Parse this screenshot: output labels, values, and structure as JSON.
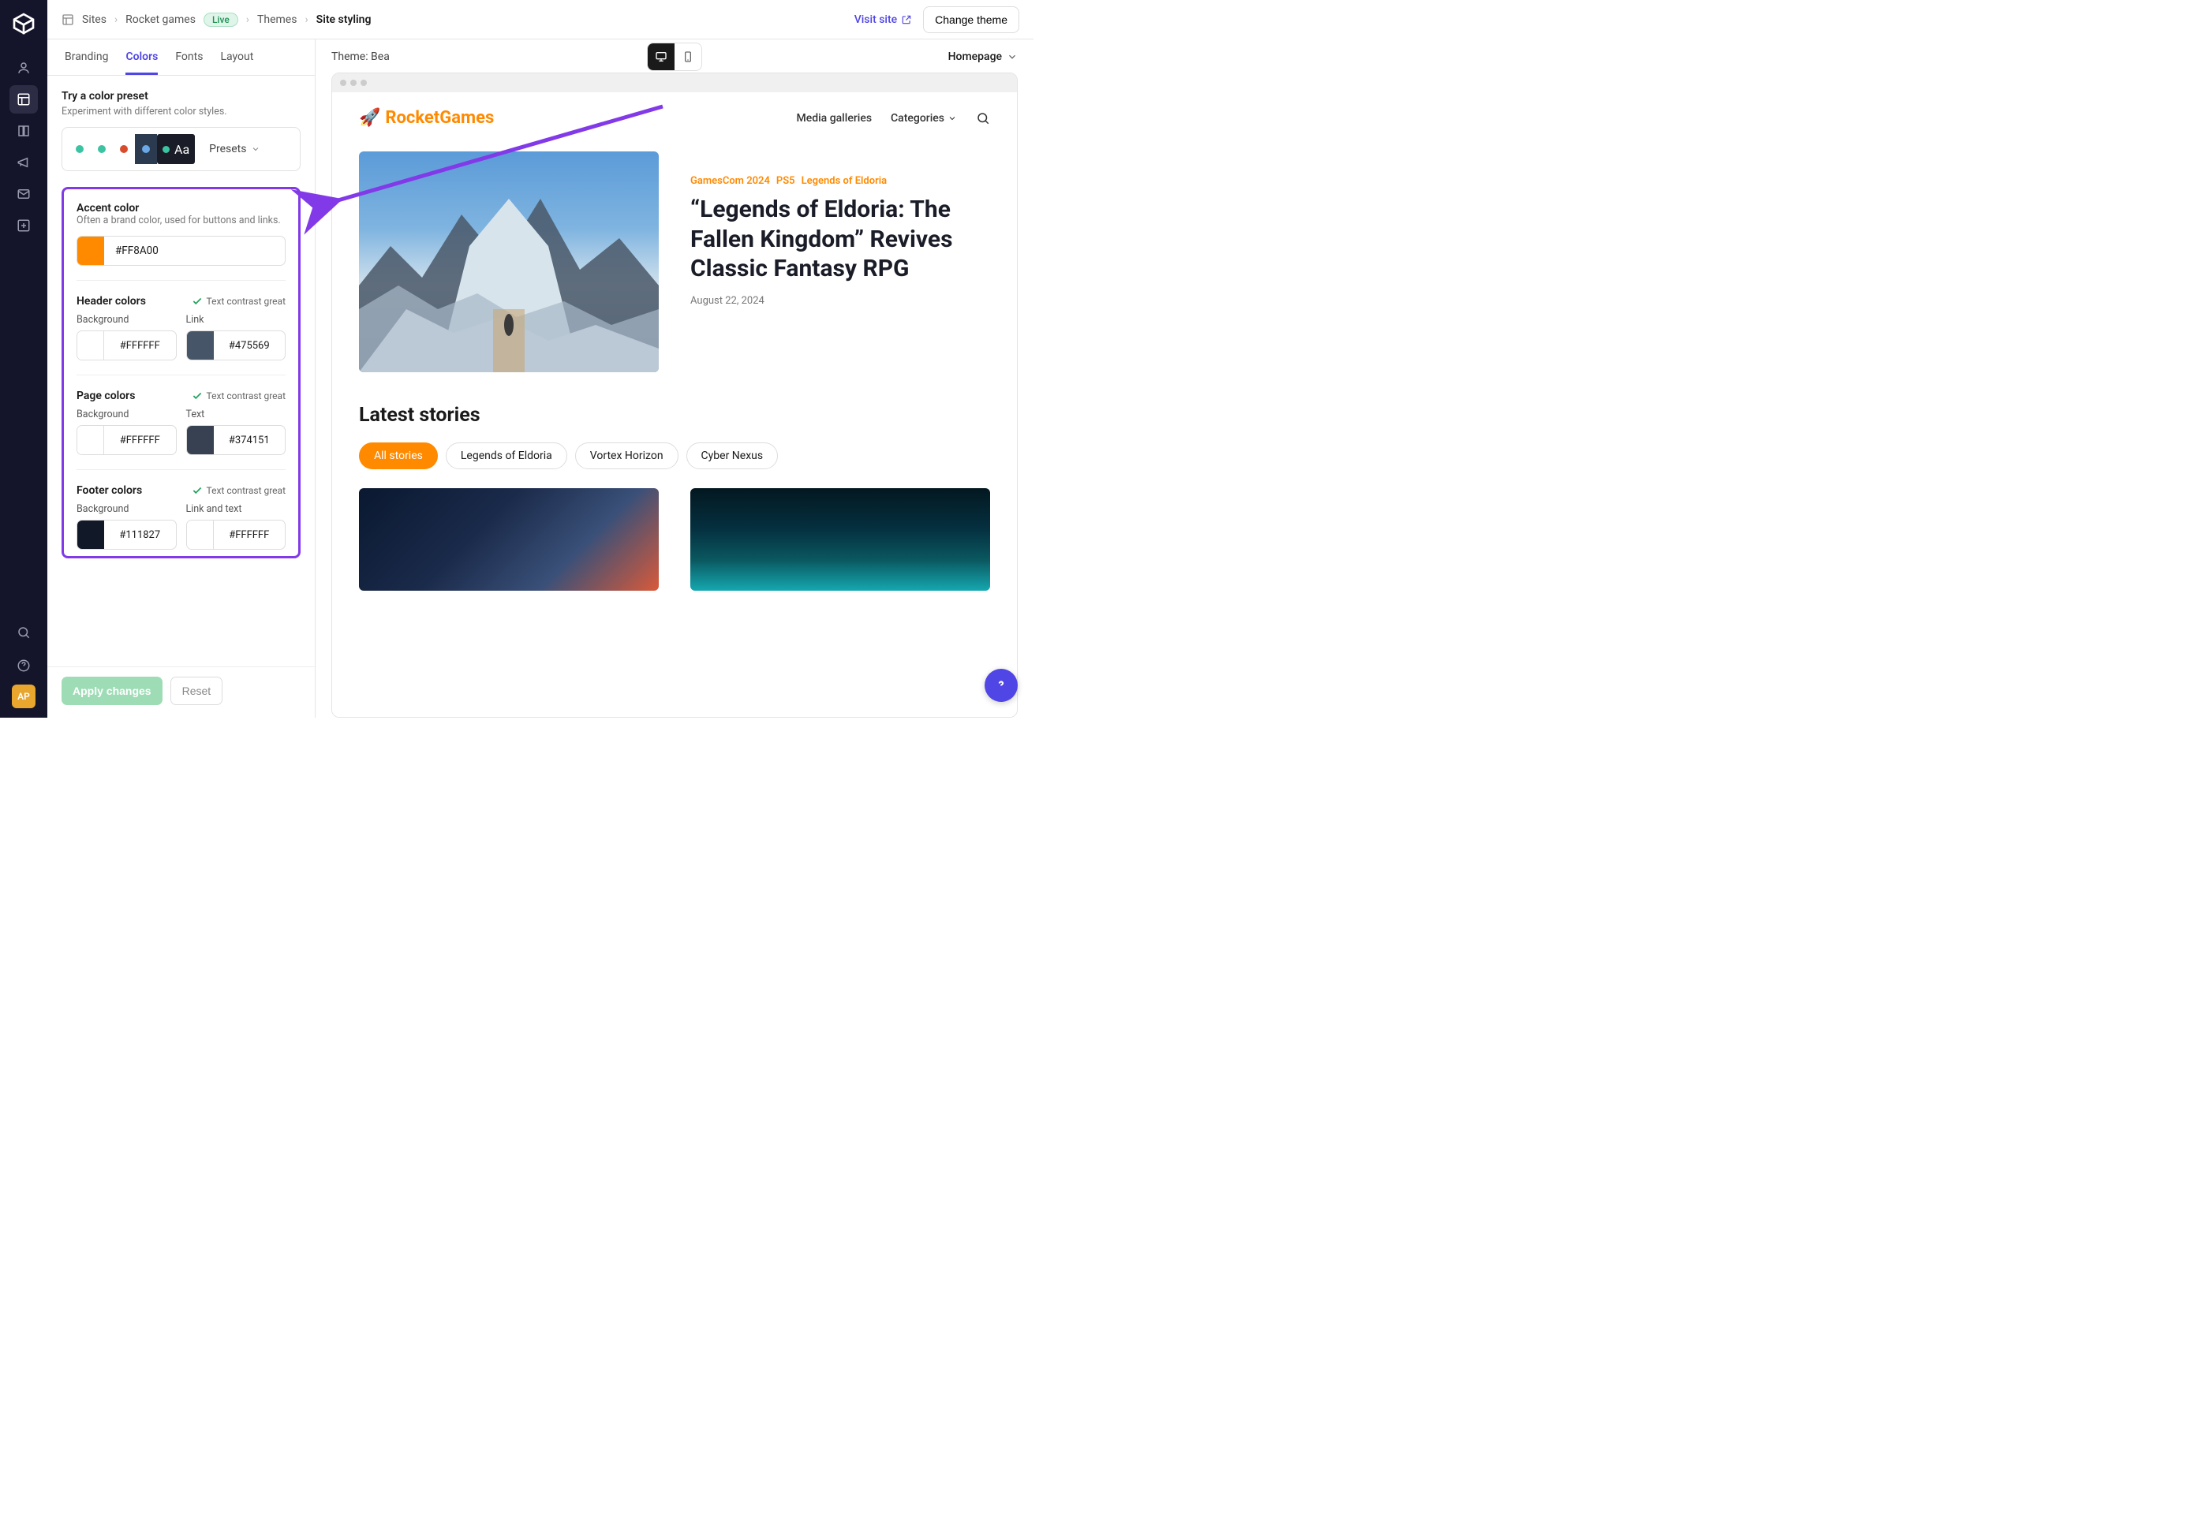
{
  "breadcrumb": {
    "sites": "Sites",
    "site_name": "Rocket games",
    "live": "Live",
    "themes": "Themes",
    "current": "Site styling"
  },
  "topbar": {
    "visit": "Visit site",
    "change_theme": "Change theme"
  },
  "tabs": {
    "branding": "Branding",
    "colors": "Colors",
    "fonts": "Fonts",
    "layout": "Layout"
  },
  "presets_section": {
    "title": "Try a color preset",
    "sub": "Experiment with different color styles.",
    "dropdown": "Presets",
    "aa": "Aa"
  },
  "accent": {
    "title": "Accent color",
    "sub": "Often a brand color, used for buttons and links.",
    "value": "#FF8A00"
  },
  "contrast_label": "Text contrast great",
  "header_colors": {
    "title": "Header colors",
    "bg_label": "Background",
    "link_label": "Link",
    "bg": "#FFFFFF",
    "link": "#475569"
  },
  "page_colors": {
    "title": "Page colors",
    "bg_label": "Background",
    "text_label": "Text",
    "bg": "#FFFFFF",
    "text": "#374151"
  },
  "footer_colors": {
    "title": "Footer colors",
    "bg_label": "Background",
    "linktext_label": "Link and text",
    "bg": "#111827",
    "linktext": "#FFFFFF"
  },
  "footer_btns": {
    "apply": "Apply changes",
    "reset": "Reset"
  },
  "preview": {
    "theme_label": "Theme: Bea",
    "page": "Homepage"
  },
  "site": {
    "logo": "RocketGames",
    "nav": {
      "media": "Media galleries",
      "categories": "Categories"
    },
    "hero_tags": {
      "t1": "GamesCom 2024",
      "t2": "PS5",
      "t3": "Legends of Eldoria"
    },
    "hero_title": "“Legends of Eldoria: The Fallen Kingdom” Revives Classic Fantasy RPG",
    "hero_date": "August 22, 2024",
    "latest": "Latest stories",
    "pills": {
      "all": "All stories",
      "p1": "Legends of Eldoria",
      "p2": "Vortex Horizon",
      "p3": "Cyber Nexus"
    }
  },
  "avatar": "AP"
}
